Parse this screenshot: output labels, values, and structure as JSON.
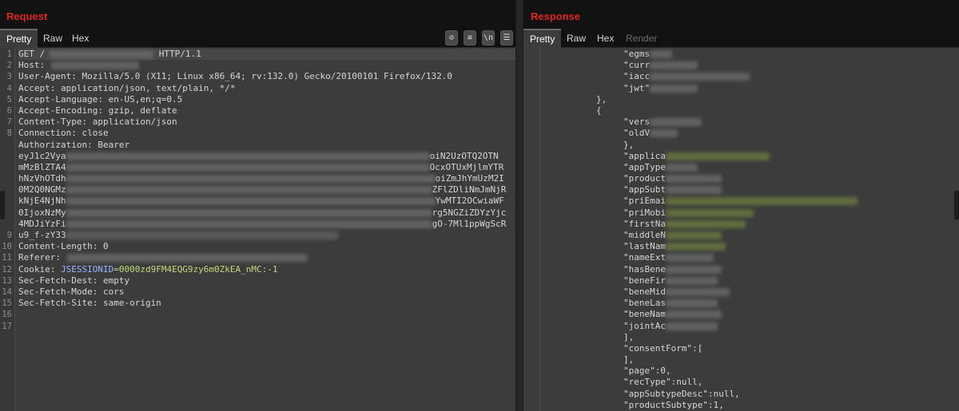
{
  "request": {
    "title": "Request",
    "tabs": [
      "Pretty",
      "Raw",
      "Hex"
    ],
    "active_tab": "Pretty",
    "line_numbers": [
      "1",
      "2",
      "3",
      "4",
      "5",
      "6",
      "7",
      "8",
      "",
      "",
      "",
      "",
      "",
      "",
      "",
      "",
      "9",
      "10",
      "11",
      "12",
      "13",
      "14",
      "15",
      "16",
      "17"
    ],
    "lines": {
      "l1_method": "GET /",
      "l1_version": "HTTP/1.1",
      "l2": "Host:",
      "l3": "User-Agent: Mozilla/5.0 (X11; Linux x86_64; rv:132.0) Gecko/20100101 Firefox/132.0",
      "l4": "Accept: application/json, text/plain, */*",
      "l5": "Accept-Language: en-US,en;q=0.5",
      "l6": "Accept-Encoding: gzip, deflate",
      "l7": "Content-Type: application/json",
      "l8": "Connection: close",
      "l9": "Authorization: Bearer",
      "jwt": [
        {
          "start": "eyJ1c2Vya",
          "end": "oiN2UzOTQ2OTN"
        },
        {
          "start": "mMzBlZTA4",
          "end": "OcxOTUxMjlmYTR"
        },
        {
          "start": "hNzVhOTdh",
          "end": "oiZmJhYmUzM2I"
        },
        {
          "start": "0M2Q0NGMz",
          "end": "ZFlZDliNmJmNjR"
        },
        {
          "start": "kNjE4NjNh",
          "end": "YwMTI2OCwiaWF"
        },
        {
          "start": "0IjoxNzMy",
          "end": "rg5NGZiZDYzYjc"
        },
        {
          "start": "4MDJiYzFi",
          "end": "gO-7Ml1ppWgScR"
        },
        {
          "start": "u9_f-zY33",
          "end": ""
        }
      ],
      "l10": "Content-Length: 0",
      "l11": "Referer:",
      "l12_label": "Cookie: ",
      "l12_name": "JSESSIONID",
      "l12_value": "=0000zd9FM4EQG9zy6m0ZkEA_nMC:-1",
      "l13": "Sec-Fetch-Dest: empty",
      "l14": "Sec-Fetch-Mode: cors",
      "l15": "Sec-Fetch-Site: same-origin"
    },
    "tools": [
      {
        "icon": "eye-off-icon",
        "glyph": "⊘"
      },
      {
        "icon": "wrap-icon",
        "glyph": "≡"
      },
      {
        "icon": "newline-icon",
        "glyph": "\\n"
      },
      {
        "icon": "menu-icon",
        "glyph": "☰"
      }
    ]
  },
  "response": {
    "title": "Response",
    "tabs": [
      "Pretty",
      "Raw",
      "Hex",
      "Render"
    ],
    "active_tab": "Pretty",
    "keys": {
      "egms": "\"egms",
      "curr": "\"curr",
      "iacc": "\"iacc",
      "jwt": "\"jwt\"",
      "close_obj": "},",
      "open_obj": "{",
      "vers": "\"vers",
      "oldV": "\"oldV",
      "close_inner": "},",
      "applica": "\"applica",
      "appType": "\"appType",
      "product": "\"product",
      "appSubt": "\"appSubt",
      "priEmai": "\"priEmai",
      "priMobi": "\"priMobi",
      "firstNa": "\"firstNa",
      "middleN": "\"middleN",
      "lastNam": "\"lastNam",
      "nameExt": "\"nameExt",
      "hasBene": "\"hasBene",
      "beneFir": "\"beneFir",
      "beneMid": "\"beneMid",
      "beneLas": "\"beneLas",
      "beneNam": "\"beneNam",
      "jointAc": "\"jointAc",
      "close_arr": "],",
      "consentForm": "\"consentForm\":[",
      "close_arr2": "],",
      "page": "\"page\":0,",
      "recType": "\"recType\":null,",
      "appSubtypeDesc": "\"appSubtypeDesc\":null,",
      "productSubtype": "\"productSubtype\":1,"
    }
  },
  "colors": {
    "title_red": "#e0251e",
    "cookie_name": "#9ab3ff",
    "cookie_value": "#c3d97a"
  }
}
